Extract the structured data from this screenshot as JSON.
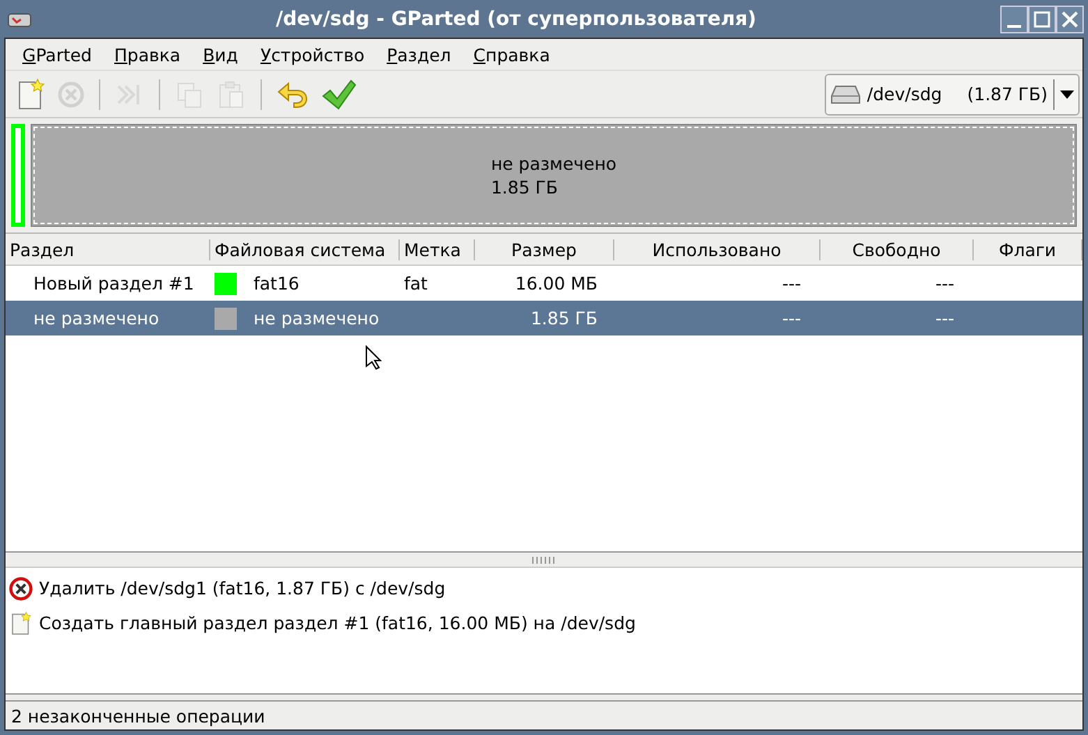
{
  "window": {
    "title": "/dev/sdg - GParted (от суперпользователя)"
  },
  "menu": [
    "GParted",
    "Правка",
    "Вид",
    "Устройство",
    "Раздел",
    "Справка"
  ],
  "toolbar": [
    {
      "kind": "new",
      "disabled": false
    },
    {
      "kind": "delete",
      "disabled": true
    },
    {
      "kind": "sep"
    },
    {
      "kind": "resize",
      "disabled": true
    },
    {
      "kind": "sep"
    },
    {
      "kind": "copy",
      "disabled": true
    },
    {
      "kind": "paste",
      "disabled": true
    },
    {
      "kind": "sep"
    },
    {
      "kind": "undo",
      "disabled": false
    },
    {
      "kind": "apply",
      "disabled": false
    }
  ],
  "device": {
    "name": "/dev/sdg",
    "size": "(1.87 ГБ)"
  },
  "disk_map": [
    {
      "kind": "partition",
      "color": "#00ff00",
      "selected": false
    },
    {
      "kind": "unallocated",
      "color": "#a9a9a9",
      "selected": true,
      "label": "не размечено",
      "size": "1.85 ГБ"
    }
  ],
  "table": {
    "columns": [
      "Раздел",
      "Файловая система",
      "Метка",
      "Размер",
      "Использовано",
      "Свободно",
      "Флаги"
    ],
    "rows": [
      {
        "partition": "Новый раздел #1",
        "color": "#00ff00",
        "filesystem": "fat16",
        "label": "fat",
        "size": "16.00 МБ",
        "used": "---",
        "unused": "---",
        "selected": false
      },
      {
        "partition": "не размечено",
        "color": "#a9a9a9",
        "filesystem": "не размечено",
        "size": "1.85 ГБ",
        "used": "---",
        "unused": "---",
        "selected": true
      }
    ]
  },
  "operations": [
    {
      "kind": "delete",
      "text": "Удалить  /dev/sdg1 (fat16, 1.87 ГБ) с /dev/sdg"
    },
    {
      "kind": "new",
      "text": "Создать главный раздел раздел #1 (fat16, 16.00 МБ) на /dev/sdg"
    }
  ],
  "status_bar": "2 незаконченные операции"
}
